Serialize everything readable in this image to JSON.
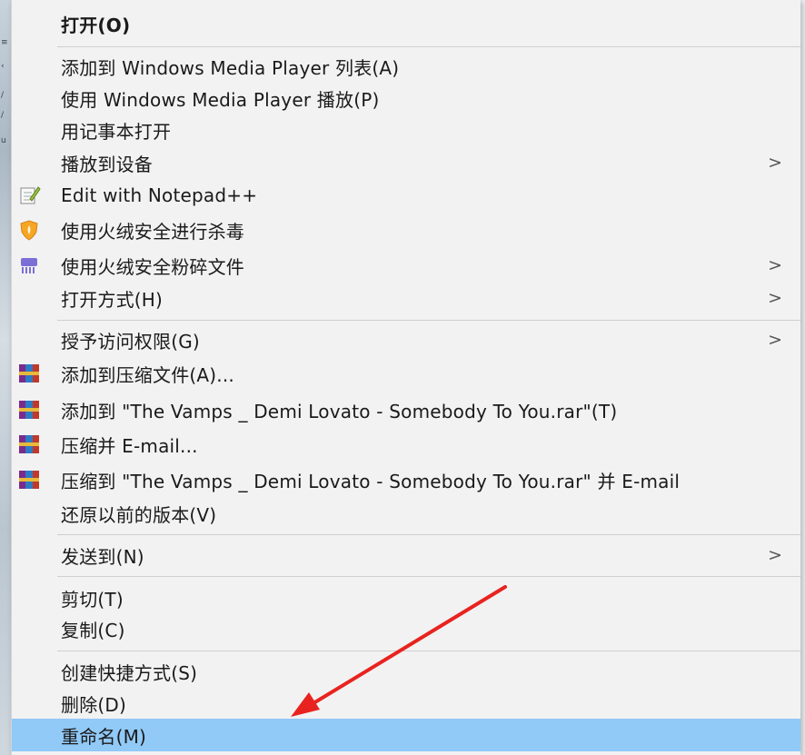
{
  "menu": {
    "items": [
      {
        "label": "打开(O)"
      },
      {
        "label": "添加到 Windows Media Player 列表(A)"
      },
      {
        "label": "使用 Windows Media Player 播放(P)"
      },
      {
        "label": "用记事本打开"
      },
      {
        "label": "播放到设备"
      },
      {
        "label": "Edit with Notepad++"
      },
      {
        "label": "使用火绒安全进行杀毒"
      },
      {
        "label": "使用火绒安全粉碎文件"
      },
      {
        "label": "打开方式(H)"
      },
      {
        "label": "授予访问权限(G)"
      },
      {
        "label": "添加到压缩文件(A)..."
      },
      {
        "label": "添加到 \"The Vamps _ Demi Lovato - Somebody To You.rar\"(T)"
      },
      {
        "label": "压缩并 E-mail..."
      },
      {
        "label": "压缩到 \"The Vamps _ Demi Lovato - Somebody To You.rar\" 并 E-mail"
      },
      {
        "label": "还原以前的版本(V)"
      },
      {
        "label": "发送到(N)"
      },
      {
        "label": "剪切(T)"
      },
      {
        "label": "复制(C)"
      },
      {
        "label": "创建快捷方式(S)"
      },
      {
        "label": "删除(D)"
      },
      {
        "label": "重命名(M)"
      }
    ],
    "submenu_arrow": ">",
    "highlight_color": "#91c9f7"
  },
  "annotation": {
    "arrow_color": "#e8231f"
  }
}
